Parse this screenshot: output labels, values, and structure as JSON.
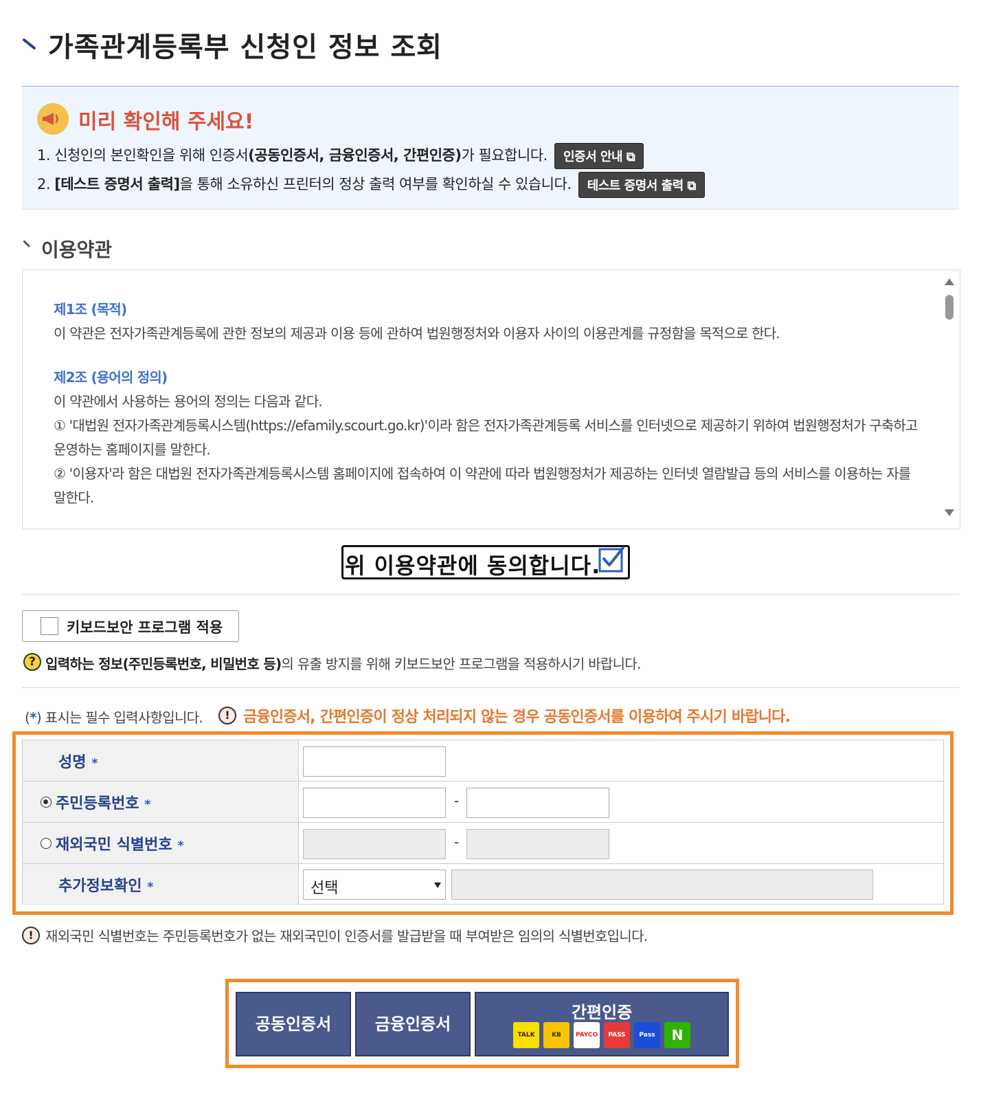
{
  "page": {
    "title": "가족관계등록부 신청인 정보 조회"
  },
  "notice": {
    "title": "미리 확인해 주세요!",
    "line1_pre": "1. 신청인의 본인확인을 위해 인증서",
    "line1_bold": "(공동인증서, 금융인증서, 간편인증)",
    "line1_post": "가 필요합니다.",
    "cert_guide_button": "인증서 안내",
    "line2_pre": "2. ",
    "line2_bold": "[테스트 증명서 출력]",
    "line2_post": "을 통해 소유하신 프린터의 정상 출력 여부를 확인하실 수 있습니다.",
    "test_print_button": "테스트 증명서 출력"
  },
  "terms": {
    "heading": "이용약관",
    "article1_title": "제1조 (목적)",
    "article1_body": "이 약관은 전자가족관계등록에 관한 정보의 제공과 이용 등에 관하여 법원행정처와 이용자 사이의 이용관계를 규정함을 목적으로 한다.",
    "article2_title": "제2조 (용어의 정의)",
    "article2_body": "이 약관에서 사용하는 용어의 정의는 다음과 같다.",
    "article2_item1": "① '대법원 전자가족관계등록시스템(https://efamily.scourt.go.kr)'이라 함은 전자가족관계등록 서비스를 인터넷으로 제공하기 위하여 법원행정처가 구축하고 운영하는 홈페이지를 말한다.",
    "article2_item2": "② '이용자'라 함은 대법원 전자가족관계등록시스템 홈페이지에 접속하여 이 약관에 따라 법원행정처가 제공하는 인터넷 열람발급 등의 서비스를 이용하는 자를 말한다.",
    "agree_label": "위 이용약관에 동의합니다."
  },
  "keyboard": {
    "label": "키보드보안 프로그램 적용",
    "help_bold": "입력하는 정보(주민등록번호, 비밀번호 등)",
    "help_rest": "의 유출 방지를 위해 키보드보안 프로그램을 적용하시기 바랍니다."
  },
  "required_note": {
    "star": "*",
    "text": "표시는 필수 입력사항입니다.",
    "open": "(",
    "close": ")"
  },
  "warning": "금융인증서, 간편인증이 정상 처리되지 않는 경우 공동인증서를 이용하여 주시기 바랍니다.",
  "form": {
    "name_label": "성명",
    "rrn_label": "주민등록번호",
    "foreign_label": "재외국민 식별번호",
    "extra_label": "추가정보확인",
    "required_mark": "*",
    "dash": "-",
    "extra_select_value": "선택",
    "name_value": "",
    "rrn_front": "",
    "rrn_back": ""
  },
  "foreign_note": "재외국민 식별번호는 주민등록번호가 없는 재외국민이 인증서를 발급받을 때 부여받은 임의의 식별번호입니다.",
  "buttons": {
    "joint_cert": "공동인증서",
    "financial_cert": "금융인증서",
    "simple_auth": "간편인증"
  },
  "providers": [
    "TALK",
    "KB",
    "PAYCO",
    "PASS",
    "Pass",
    "N"
  ],
  "colors": {
    "accent_orange": "#f28b2a",
    "button_navy": "#4a5a8c",
    "label_blue": "#27408b",
    "warn_orange": "#e2782e"
  }
}
